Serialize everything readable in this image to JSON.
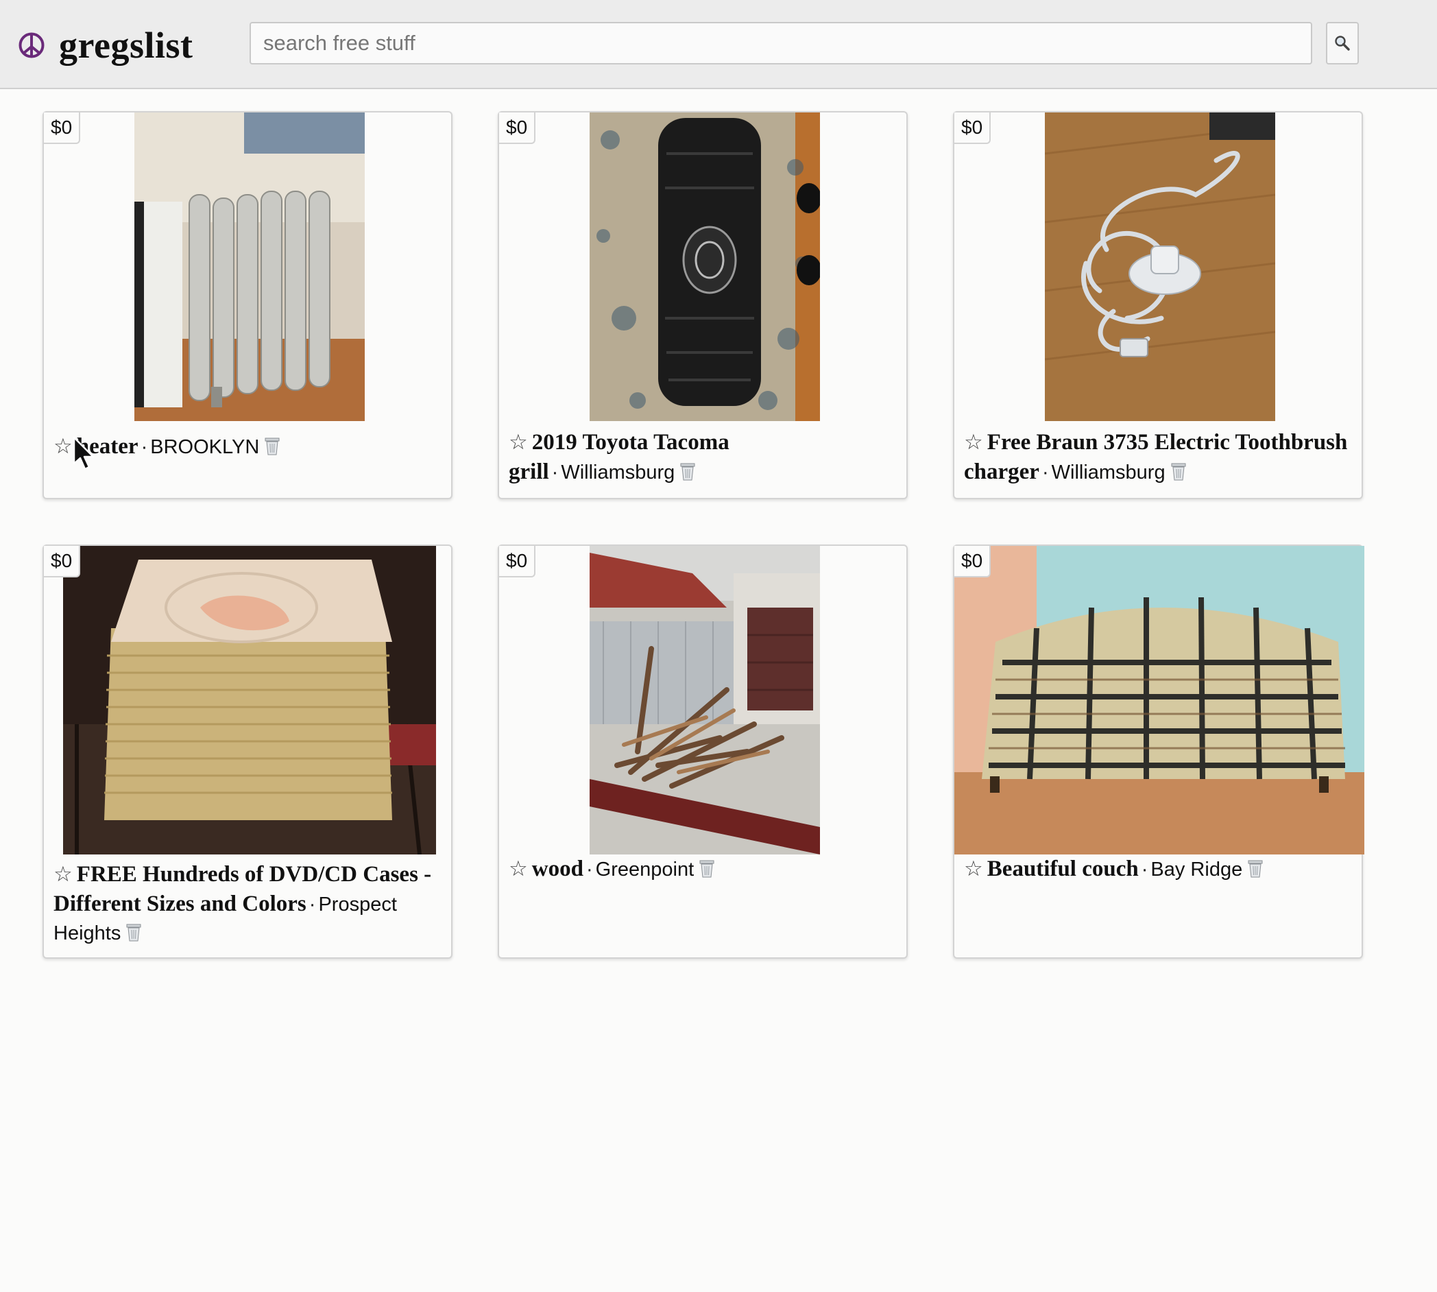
{
  "header": {
    "brand": "gregslist",
    "search_placeholder": "search free stuff"
  },
  "listings": [
    {
      "price": "$0",
      "title": "heater",
      "location": "BROOKLYN"
    },
    {
      "price": "$0",
      "title": "2019 Toyota Tacoma grill",
      "location": "Williamsburg"
    },
    {
      "price": "$0",
      "title": "Free Braun 3735 Electric Toothbrush charger",
      "location": "Williamsburg"
    },
    {
      "price": "$0",
      "title": "FREE Hundreds of DVD/CD Cases - Different Sizes and Colors",
      "location": "Prospect Heights"
    },
    {
      "price": "$0",
      "title": "wood",
      "location": "Greenpoint"
    },
    {
      "price": "$0",
      "title": "Beautiful couch",
      "location": "Bay Ridge"
    }
  ],
  "separator": "·",
  "colors": {
    "brand_icon": "#6a2a7a",
    "header_bg": "#ececec"
  },
  "icons": {
    "brand": "peace-icon",
    "search": "magnifier-icon",
    "favorite": "star-outline-icon",
    "delete": "trash-icon"
  }
}
